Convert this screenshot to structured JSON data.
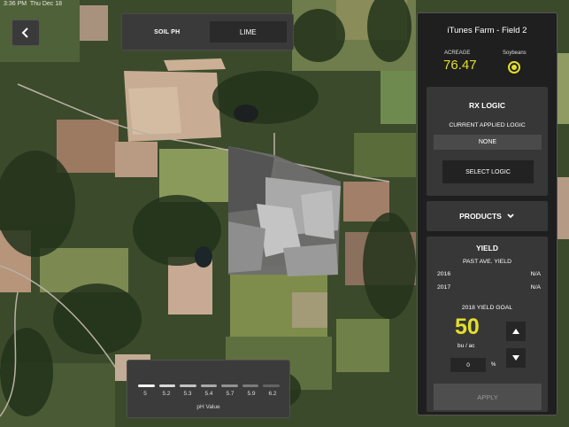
{
  "status_bar": {
    "time": "3:36 PM",
    "date": "Thu Dec 18"
  },
  "toggle": {
    "soil_ph_label": "SOIL PH",
    "lime_label": "LIME"
  },
  "legend": {
    "values": [
      "5",
      "5.2",
      "5.3",
      "5.4",
      "5.7",
      "5.9",
      "6.2"
    ],
    "swatch_colors": [
      "#f4f4f4",
      "#d9d9d9",
      "#c4c4c4",
      "#aaaaaa",
      "#929292",
      "#7b7b7b",
      "#646464"
    ],
    "title": "pH Value"
  },
  "panel": {
    "farm_title": "iTunes Farm - Field 2",
    "acreage_label": "ACREAGE",
    "acreage_value": "76.47",
    "crop_label": "Soybeans",
    "rx": {
      "title": "RX LOGIC",
      "current_label": "CURRENT APPLIED LOGIC",
      "current_value": "NONE",
      "select_button": "SELECT LOGIC"
    },
    "products_label": "PRODUCTS",
    "yield": {
      "title": "YIELD",
      "past_label": "PAST AVE. YIELD",
      "rows": [
        {
          "year": "2016",
          "value": "N/A"
        },
        {
          "year": "2017",
          "value": "N/A"
        }
      ],
      "goal_label": "2018 YIELD GOAL",
      "goal_value": "50",
      "goal_unit": "bu / ac",
      "pct_value": "0",
      "pct_symbol": "%",
      "apply_button": "APPLY"
    }
  },
  "colors": {
    "accent_yellow": "#e2df2a",
    "panel_bg": "#1f1f1f",
    "card_bg": "#373737"
  }
}
